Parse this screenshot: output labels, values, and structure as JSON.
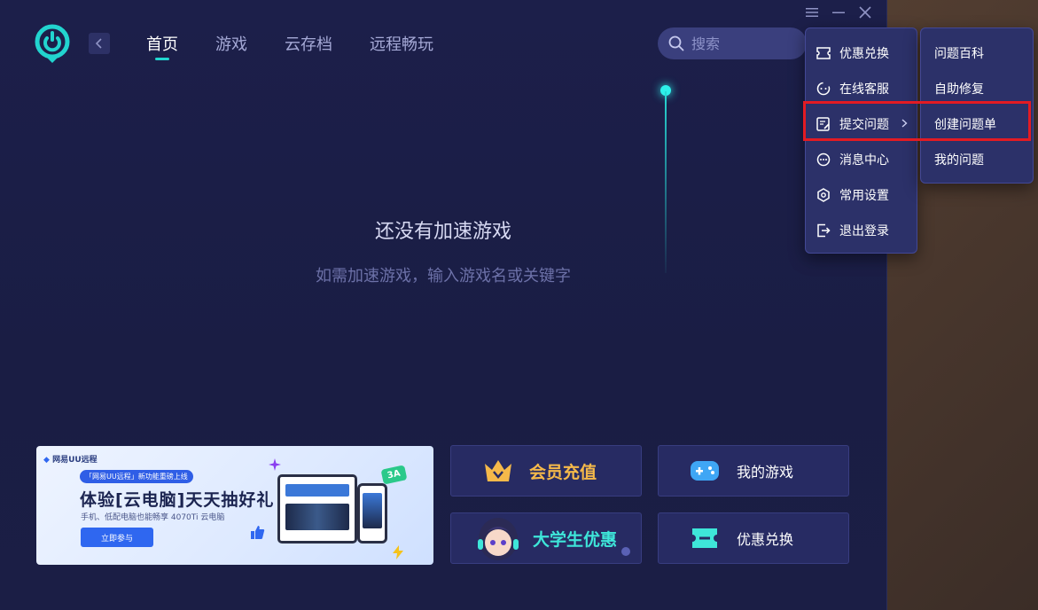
{
  "nav": {
    "tabs": [
      {
        "label": "首页",
        "active": true
      },
      {
        "label": "游戏",
        "active": false
      },
      {
        "label": "云存档",
        "active": false
      },
      {
        "label": "远程畅玩",
        "active": false
      }
    ]
  },
  "search": {
    "placeholder": "搜索"
  },
  "empty": {
    "title": "还没有加速游戏",
    "subtitle": "如需加速游戏，输入游戏名或关键字"
  },
  "banner": {
    "brand": "网易UU远程",
    "pill": "「网易UU远程」新功能重磅上线",
    "headline": "体验[云电脑]天天抽好礼",
    "subline": "手机、低配电脑也能畅享 4070Ti 云电脑",
    "cta": "立即参与",
    "badge": "3A"
  },
  "cards": {
    "vip": "会员充值",
    "my_games": "我的游戏",
    "student": "大学生优惠",
    "redeem": "优惠兑换"
  },
  "menu": {
    "items": [
      {
        "label": "优惠兑换",
        "icon": "ticket-icon"
      },
      {
        "label": "在线客服",
        "icon": "support-icon"
      },
      {
        "label": "提交问题",
        "icon": "edit-icon",
        "has_submenu": true
      },
      {
        "label": "消息中心",
        "icon": "message-icon"
      },
      {
        "label": "常用设置",
        "icon": "settings-icon"
      },
      {
        "label": "退出登录",
        "icon": "logout-icon"
      }
    ],
    "submenu": [
      {
        "label": "问题百科"
      },
      {
        "label": "自助修复"
      },
      {
        "label": "创建问题单"
      },
      {
        "label": "我的问题"
      }
    ]
  },
  "colors": {
    "accent": "#21d6d0",
    "background": "#1c1f4a",
    "menu_bg": "#2c3169",
    "highlight": "#e31b23",
    "vip": "#f5b94a"
  }
}
